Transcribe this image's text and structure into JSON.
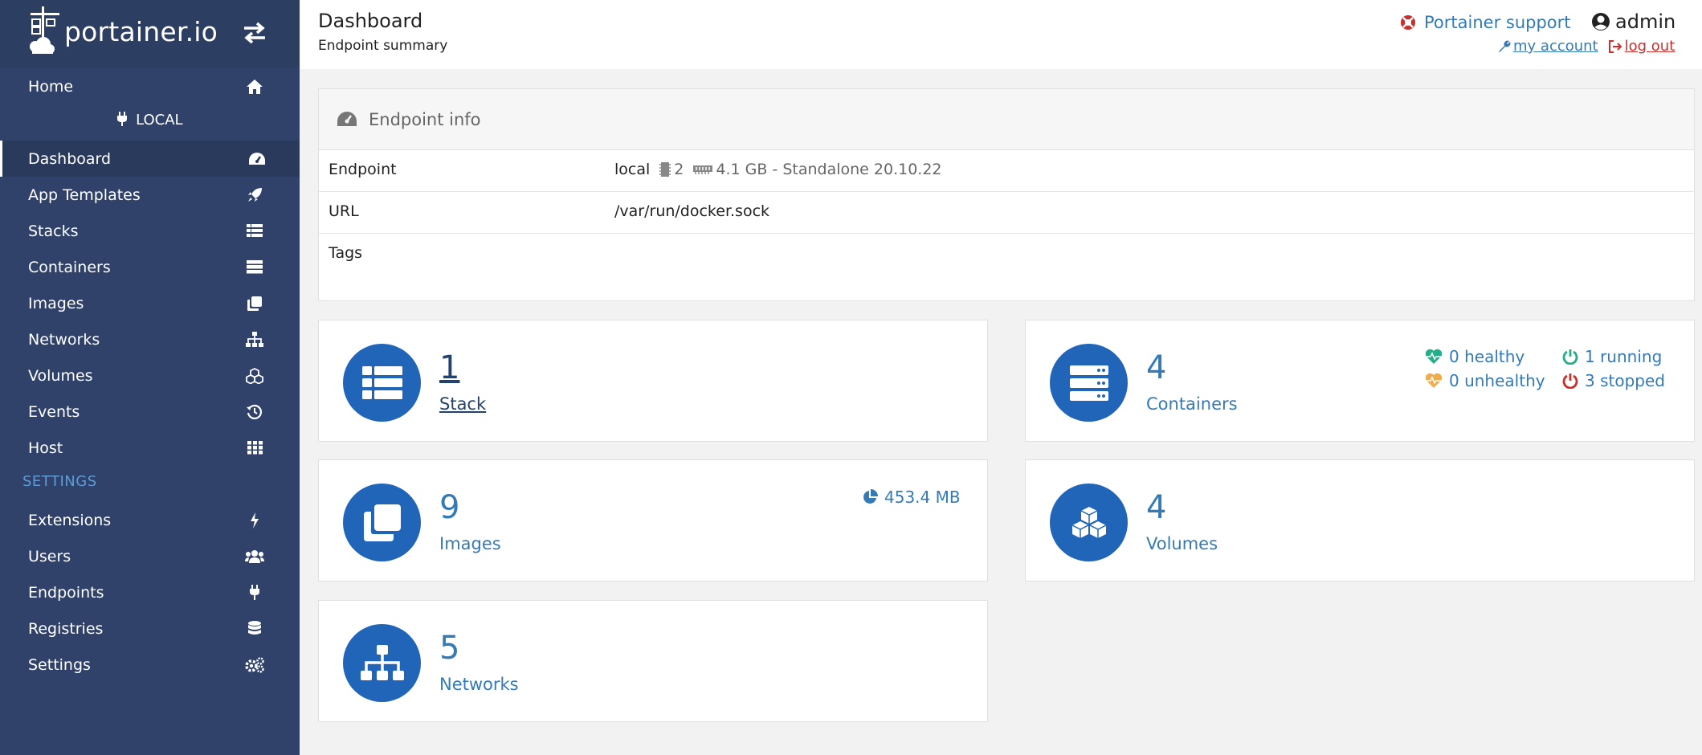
{
  "brand": {
    "name": "portainer.io"
  },
  "sidebar": {
    "home": "Home",
    "endpoint_label": "LOCAL",
    "items": [
      {
        "label": "Dashboard",
        "icon": "tachometer-icon"
      },
      {
        "label": "App Templates",
        "icon": "rocket-icon"
      },
      {
        "label": "Stacks",
        "icon": "list-icon"
      },
      {
        "label": "Containers",
        "icon": "server-icon"
      },
      {
        "label": "Images",
        "icon": "clone-icon"
      },
      {
        "label": "Networks",
        "icon": "sitemap-icon"
      },
      {
        "label": "Volumes",
        "icon": "cubes-icon"
      },
      {
        "label": "Events",
        "icon": "history-icon"
      },
      {
        "label": "Host",
        "icon": "th-icon"
      }
    ],
    "settings_heading": "SETTINGS",
    "settings_items": [
      {
        "label": "Extensions",
        "icon": "bolt-icon"
      },
      {
        "label": "Users",
        "icon": "users-icon"
      },
      {
        "label": "Endpoints",
        "icon": "plug-icon"
      },
      {
        "label": "Registries",
        "icon": "database-icon"
      },
      {
        "label": "Settings",
        "icon": "cogs-icon"
      }
    ]
  },
  "header": {
    "title": "Dashboard",
    "subtitle": "Endpoint summary",
    "support": "Portainer support",
    "user": "admin",
    "my_account": "my account",
    "log_out": "log out"
  },
  "endpoint_info": {
    "title": "Endpoint info",
    "rows": [
      {
        "key": "Endpoint",
        "name": "local",
        "cpu": "2",
        "details": "4.1 GB - Standalone 20.10.22"
      },
      {
        "key": "URL",
        "value": "/var/run/docker.sock"
      },
      {
        "key": "Tags",
        "value": ""
      }
    ]
  },
  "cards": {
    "stack": {
      "count": "1",
      "label": "Stack"
    },
    "containers": {
      "count": "4",
      "label": "Containers",
      "healthy": "0 healthy",
      "unhealthy": "0 unhealthy",
      "running": "1 running",
      "stopped": "3 stopped"
    },
    "images": {
      "count": "9",
      "label": "Images",
      "size": "453.4 MB"
    },
    "volumes": {
      "count": "4",
      "label": "Volumes"
    },
    "networks": {
      "count": "5",
      "label": "Networks"
    }
  },
  "colors": {
    "sidebar": "#30426a",
    "accent": "#337ab7",
    "circle": "#2165b9",
    "healthy": "#23ae89",
    "unhealthy": "#f0ad4e",
    "stopped": "#c9302c"
  }
}
